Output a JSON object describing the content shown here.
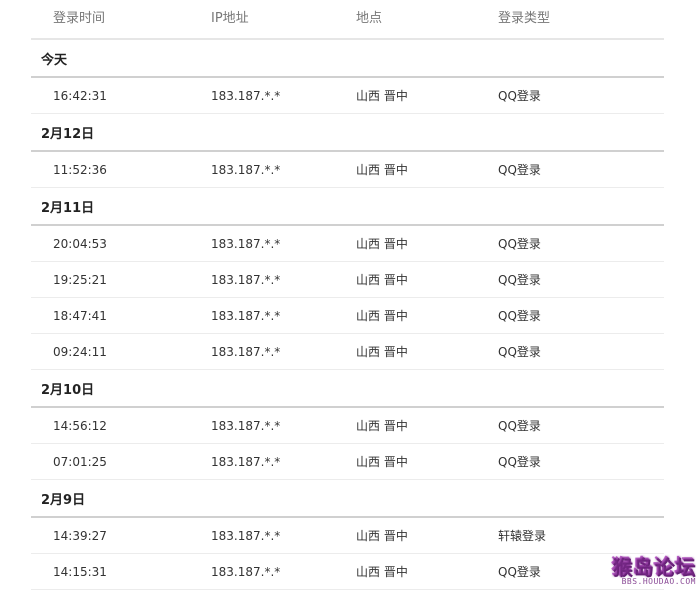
{
  "header": {
    "time": "登录时间",
    "ip": "IP地址",
    "location": "地点",
    "type": "登录类型"
  },
  "groups": [
    {
      "title": "今天",
      "rows": [
        {
          "time": "16:42:31",
          "ip": "183.187.*.*",
          "location": "山西 晋中",
          "type": "QQ登录"
        }
      ]
    },
    {
      "title": "2月12日",
      "rows": [
        {
          "time": "11:52:36",
          "ip": "183.187.*.*",
          "location": "山西 晋中",
          "type": "QQ登录"
        }
      ]
    },
    {
      "title": "2月11日",
      "rows": [
        {
          "time": "20:04:53",
          "ip": "183.187.*.*",
          "location": "山西 晋中",
          "type": "QQ登录"
        },
        {
          "time": "19:25:21",
          "ip": "183.187.*.*",
          "location": "山西 晋中",
          "type": "QQ登录"
        },
        {
          "time": "18:47:41",
          "ip": "183.187.*.*",
          "location": "山西 晋中",
          "type": "QQ登录"
        },
        {
          "time": "09:24:11",
          "ip": "183.187.*.*",
          "location": "山西 晋中",
          "type": "QQ登录"
        }
      ]
    },
    {
      "title": "2月10日",
      "rows": [
        {
          "time": "14:56:12",
          "ip": "183.187.*.*",
          "location": "山西 晋中",
          "type": "QQ登录"
        },
        {
          "time": "07:01:25",
          "ip": "183.187.*.*",
          "location": "山西 晋中",
          "type": "QQ登录"
        }
      ]
    },
    {
      "title": "2月9日",
      "rows": [
        {
          "time": "14:39:27",
          "ip": "183.187.*.*",
          "location": "山西 晋中",
          "type": "轩辕登录"
        },
        {
          "time": "14:15:31",
          "ip": "183.187.*.*",
          "location": "山西 晋中",
          "type": "QQ登录"
        }
      ]
    }
  ],
  "watermark": {
    "text": "猴岛论坛",
    "url": "BBS.HOUDAO.COM"
  }
}
